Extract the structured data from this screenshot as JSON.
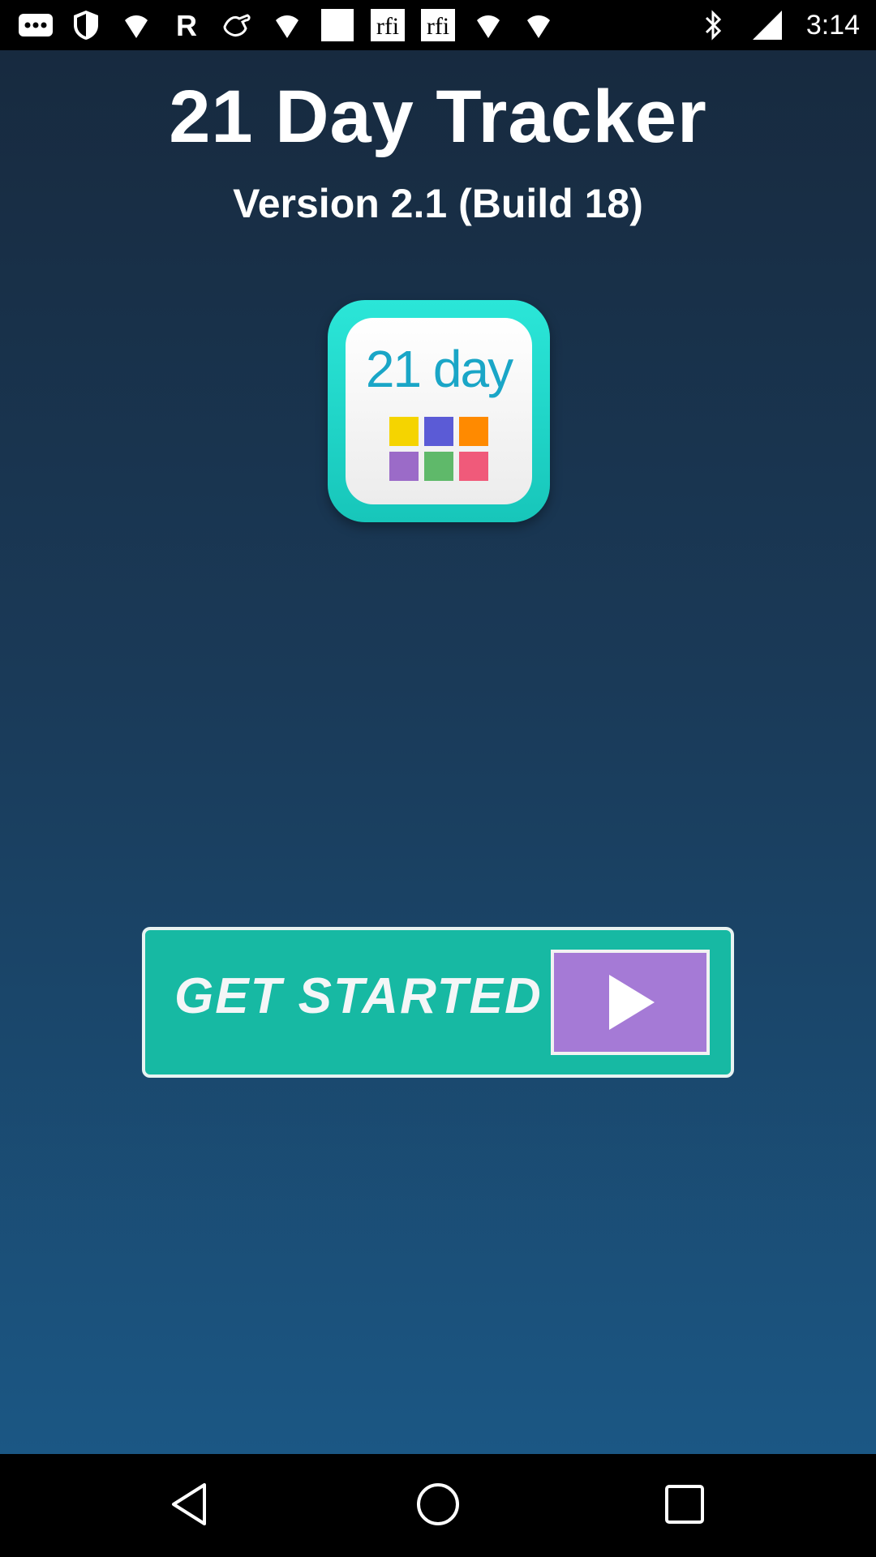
{
  "status_bar": {
    "time": "3:14",
    "left_icons": [
      "more-dots-icon",
      "shield-icon",
      "wifi-icon",
      "r-app-icon",
      "hand-icon",
      "wifi-icon",
      "blank-icon",
      "rfi-icon",
      "rfi-icon",
      "wifi-icon",
      "wifi-icon"
    ],
    "right_icons": [
      "bluetooth-icon",
      "signal-icon"
    ],
    "rfi_label": "rfi"
  },
  "app": {
    "title": "21 Day Tracker",
    "subtitle": "Version 2.1 (Build 18)",
    "icon_label": "21 day",
    "icon_grid_colors": [
      "#f5d400",
      "#5b5bd6",
      "#ff8a00",
      "#9b6bc8",
      "#5fb96a",
      "#f05a7a"
    ],
    "get_started_label": "GET STARTED",
    "colors": {
      "background_top": "#172a3f",
      "background_bottom": "#1b5784",
      "icon_teal": "#20d6c8",
      "button_teal": "#17b9a3",
      "play_purple": "#a57ad6"
    }
  },
  "nav_bar": {
    "buttons": [
      "back-icon",
      "home-icon",
      "recents-icon"
    ]
  }
}
